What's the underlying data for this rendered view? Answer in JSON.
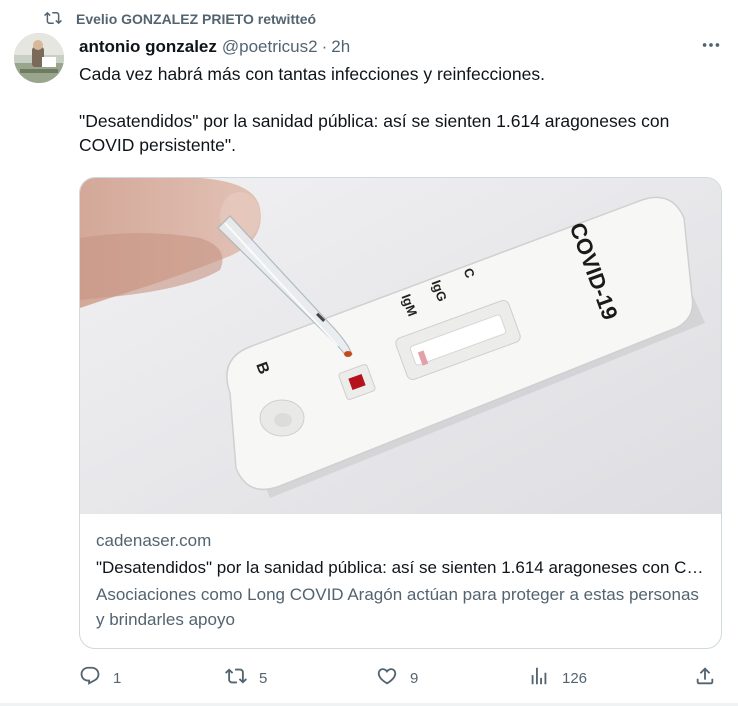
{
  "retweet": {
    "text": "Evelio GONZALEZ PRIETO retwitteó"
  },
  "author": {
    "name": "antonio gonzalez",
    "handle": "@poetricus2",
    "separator": "·",
    "time": "2h"
  },
  "tweet": {
    "line1": "Cada vez habrá más con tantas infecciones y reinfecciones.",
    "line2": "\"Desatendidos\" por la sanidad pública: así se sienten 1.614 aragoneses con COVID persistente\"."
  },
  "card": {
    "domain": "cadenaser.com",
    "title": "\"Desatendidos\" por la sanidad pública: así se sienten 1.614 aragoneses con COVID persistente",
    "description": "Asociaciones como Long COVID Aragón actúan para proteger a estas personas y brindarles apoyo",
    "image_labels": {
      "brand": "COVID-19",
      "c": "C",
      "igg": "IgG",
      "igm": "IgM",
      "b": "B"
    }
  },
  "actions": {
    "reply_count": "1",
    "retweet_count": "5",
    "like_count": "9",
    "views_count": "126"
  },
  "icons": [
    "retweet-icon",
    "more-icon",
    "reply-icon",
    "like-icon",
    "views-icon",
    "share-icon"
  ],
  "colors": {
    "text": "#0f1419",
    "secondary": "#536471",
    "border": "#cfd9de"
  }
}
